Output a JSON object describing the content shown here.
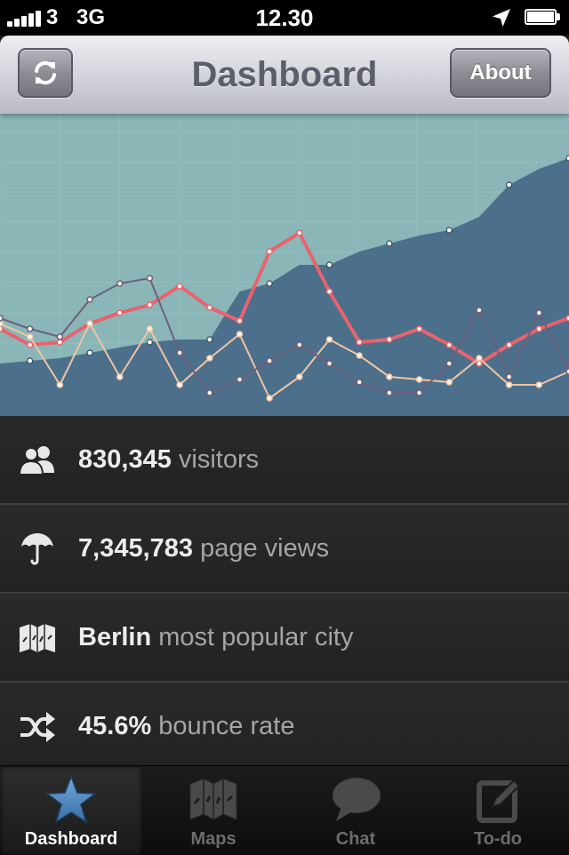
{
  "status_bar": {
    "carrier": "3",
    "network": "3G",
    "time": "12.30",
    "signal_bars": 5,
    "battery_level": 1.0,
    "icons": [
      "signal-icon",
      "location-arrow-icon",
      "battery-icon"
    ]
  },
  "nav": {
    "title": "Dashboard",
    "refresh_icon": "refresh-icon",
    "about_label": "About"
  },
  "stats": [
    {
      "icon": "users-icon",
      "value": "830,345",
      "label": "visitors"
    },
    {
      "icon": "umbrella-icon",
      "value": "7,345,783",
      "label": "page views"
    },
    {
      "icon": "map-icon",
      "value": "Berlin",
      "label": "most popular city"
    },
    {
      "icon": "shuffle-icon",
      "value": "45.6%",
      "label": "bounce rate"
    }
  ],
  "tabs": [
    {
      "label": "Dashboard",
      "icon": "star-icon",
      "active": true
    },
    {
      "label": "Maps",
      "icon": "map-icon",
      "active": false
    },
    {
      "label": "Chat",
      "icon": "speech-bubble-icon",
      "active": false
    },
    {
      "label": "To-do",
      "icon": "compose-icon",
      "active": false
    }
  ],
  "colors": {
    "chart_background": "#8ab6b8",
    "area_fill": "#4c6f8b",
    "red_line": "#e8636e",
    "peach_line": "#f0c4a4",
    "purple_line": "#6c607a",
    "tab_active_icon": "#4b86be"
  },
  "chart_data": {
    "type": "line",
    "x": [
      0,
      1,
      2,
      3,
      4,
      5,
      6,
      7,
      8,
      9,
      10,
      11,
      12,
      13,
      14,
      15,
      16,
      17,
      18,
      19
    ],
    "series": [
      {
        "kind": "area",
        "color": "#4c6f8b",
        "values": [
          0.13,
          0.14,
          0.15,
          0.17,
          0.19,
          0.21,
          0.22,
          0.22,
          0.4,
          0.43,
          0.5,
          0.5,
          0.55,
          0.58,
          0.61,
          0.63,
          0.68,
          0.8,
          0.86,
          0.9
        ]
      },
      {
        "kind": "line",
        "color": "#e8636e",
        "values": [
          0.26,
          0.2,
          0.21,
          0.28,
          0.32,
          0.35,
          0.42,
          0.34,
          0.29,
          0.55,
          0.62,
          0.4,
          0.21,
          0.22,
          0.26,
          0.2,
          0.13,
          0.2,
          0.26,
          0.3
        ]
      },
      {
        "kind": "line",
        "color": "#f0c4a4",
        "values": [
          0.28,
          0.23,
          0.05,
          0.28,
          0.08,
          0.26,
          0.05,
          0.15,
          0.24,
          0.0,
          0.08,
          0.22,
          0.16,
          0.08,
          0.07,
          0.06,
          0.15,
          0.05,
          0.05,
          0.1
        ]
      },
      {
        "kind": "line",
        "color": "#6c607a",
        "values": [
          0.3,
          0.26,
          0.23,
          0.37,
          0.43,
          0.45,
          0.17,
          0.02,
          0.07,
          0.14,
          0.2,
          0.13,
          0.06,
          0.02,
          0.02,
          0.13,
          0.33,
          0.08,
          0.32,
          0.1
        ]
      }
    ],
    "ylim": [
      0,
      1
    ],
    "grid": true,
    "legend": "none"
  }
}
